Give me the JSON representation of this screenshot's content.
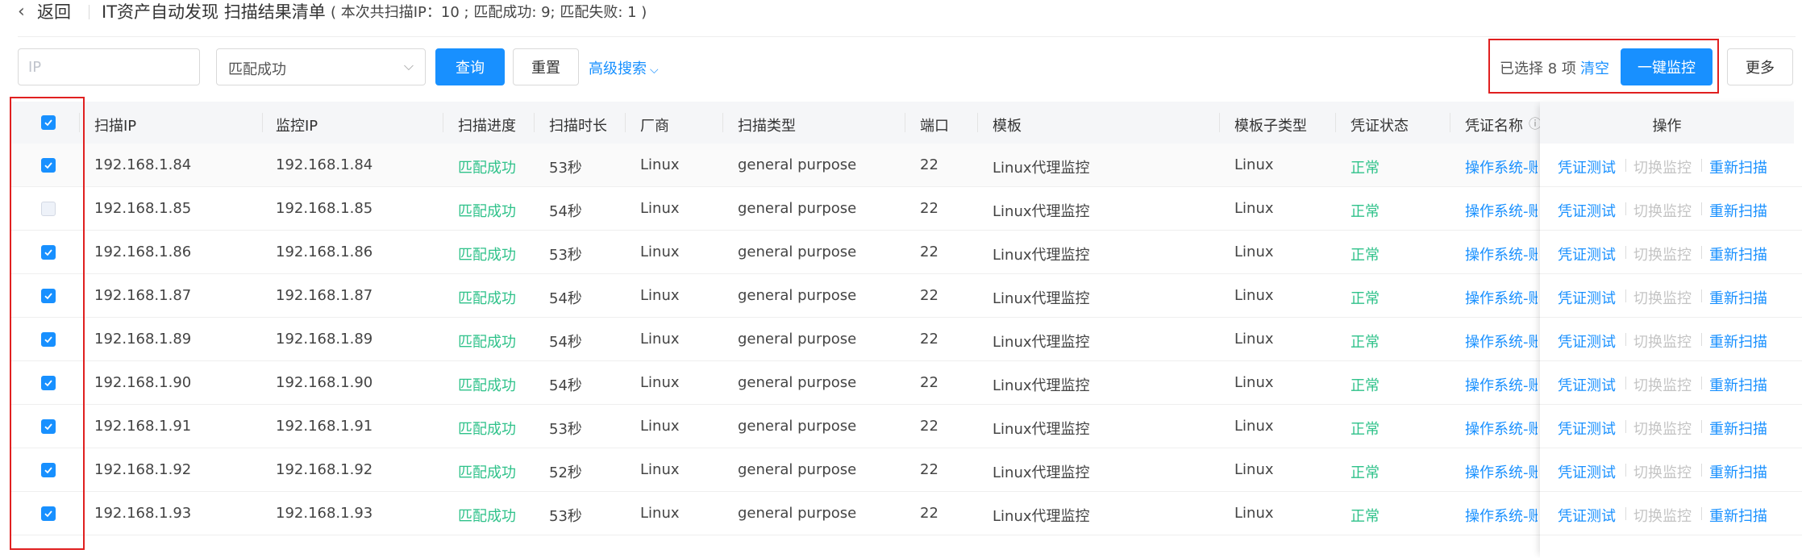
{
  "header": {
    "back_label": "返回",
    "title": "IT资产自动发现 扫描结果清单",
    "summary": "( 本次共扫描IP：10 ; 匹配成功: 9; 匹配失败: 1 )"
  },
  "toolbar": {
    "ip_placeholder": "IP",
    "status_value": "匹配成功",
    "query_label": "查询",
    "reset_label": "重置",
    "advanced_label": "高级搜索",
    "selected_text": "已选择 8 项",
    "clear_label": "清空",
    "monitor_label": "一键监控",
    "more_label": "更多"
  },
  "table": {
    "columns": {
      "scan_ip": "扫描IP",
      "monitor_ip": "监控IP",
      "progress": "扫描进度",
      "duration": "扫描时长",
      "vendor": "厂商",
      "scan_type": "扫描类型",
      "port": "端口",
      "template": "模板",
      "template_sub": "模板子类型",
      "cred_status": "凭证状态",
      "cred_name": "凭证名称",
      "actions": "操作"
    },
    "header_checked": true,
    "rows": [
      {
        "checked": true,
        "scan_ip": "192.168.1.84",
        "monitor_ip": "192.168.1.84",
        "progress": "匹配成功",
        "duration": "53秒",
        "vendor": "Linux",
        "scan_type": "general purpose",
        "port": "22",
        "template": "Linux代理监控",
        "template_sub": "Linux",
        "cred_status": "正常",
        "cred_name": "操作系统-账"
      },
      {
        "checked": false,
        "scan_ip": "192.168.1.85",
        "monitor_ip": "192.168.1.85",
        "progress": "匹配成功",
        "duration": "54秒",
        "vendor": "Linux",
        "scan_type": "general purpose",
        "port": "22",
        "template": "Linux代理监控",
        "template_sub": "Linux",
        "cred_status": "正常",
        "cred_name": "操作系统-账"
      },
      {
        "checked": true,
        "scan_ip": "192.168.1.86",
        "monitor_ip": "192.168.1.86",
        "progress": "匹配成功",
        "duration": "53秒",
        "vendor": "Linux",
        "scan_type": "general purpose",
        "port": "22",
        "template": "Linux代理监控",
        "template_sub": "Linux",
        "cred_status": "正常",
        "cred_name": "操作系统-账"
      },
      {
        "checked": true,
        "scan_ip": "192.168.1.87",
        "monitor_ip": "192.168.1.87",
        "progress": "匹配成功",
        "duration": "54秒",
        "vendor": "Linux",
        "scan_type": "general purpose",
        "port": "22",
        "template": "Linux代理监控",
        "template_sub": "Linux",
        "cred_status": "正常",
        "cred_name": "操作系统-账"
      },
      {
        "checked": true,
        "scan_ip": "192.168.1.89",
        "monitor_ip": "192.168.1.89",
        "progress": "匹配成功",
        "duration": "54秒",
        "vendor": "Linux",
        "scan_type": "general purpose",
        "port": "22",
        "template": "Linux代理监控",
        "template_sub": "Linux",
        "cred_status": "正常",
        "cred_name": "操作系统-账"
      },
      {
        "checked": true,
        "scan_ip": "192.168.1.90",
        "monitor_ip": "192.168.1.90",
        "progress": "匹配成功",
        "duration": "54秒",
        "vendor": "Linux",
        "scan_type": "general purpose",
        "port": "22",
        "template": "Linux代理监控",
        "template_sub": "Linux",
        "cred_status": "正常",
        "cred_name": "操作系统-账"
      },
      {
        "checked": true,
        "scan_ip": "192.168.1.91",
        "monitor_ip": "192.168.1.91",
        "progress": "匹配成功",
        "duration": "53秒",
        "vendor": "Linux",
        "scan_type": "general purpose",
        "port": "22",
        "template": "Linux代理监控",
        "template_sub": "Linux",
        "cred_status": "正常",
        "cred_name": "操作系统-账"
      },
      {
        "checked": true,
        "scan_ip": "192.168.1.92",
        "monitor_ip": "192.168.1.92",
        "progress": "匹配成功",
        "duration": "52秒",
        "vendor": "Linux",
        "scan_type": "general purpose",
        "port": "22",
        "template": "Linux代理监控",
        "template_sub": "Linux",
        "cred_status": "正常",
        "cred_name": "操作系统-账"
      },
      {
        "checked": true,
        "scan_ip": "192.168.1.93",
        "monitor_ip": "192.168.1.93",
        "progress": "匹配成功",
        "duration": "53秒",
        "vendor": "Linux",
        "scan_type": "general purpose",
        "port": "22",
        "template": "Linux代理监控",
        "template_sub": "Linux",
        "cred_status": "正常",
        "cred_name": "操作系统-账"
      }
    ],
    "row_actions": {
      "test_cred": "凭证测试",
      "switch_monitor": "切换监控",
      "rescan": "重新扫描"
    }
  },
  "colors": {
    "primary": "#1890ff",
    "success": "#2fc28a",
    "highlight_border": "#e02020"
  }
}
